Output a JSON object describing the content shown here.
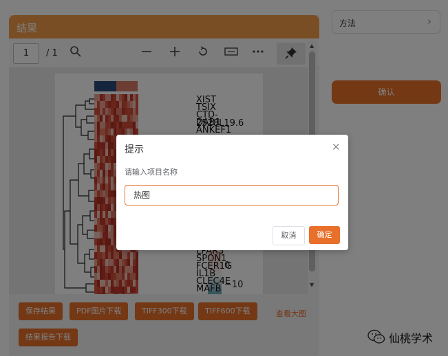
{
  "result_panel": {
    "title": "结果",
    "toolbar": {
      "page_number": "1",
      "page_total": "/ 1",
      "icons": [
        "search-icon",
        "zoom-out-icon",
        "zoom-in-icon",
        "rotate-icon",
        "fit-width-icon",
        "more-icon",
        "pin-icon"
      ]
    },
    "heatmap": {
      "genes": [
        "XIST",
        "TSIX",
        "CTD-2528L19.6",
        "DAB1",
        "ANKEF1",
        "LPAR3",
        "SPON1",
        "FCER1G",
        "IL1B",
        "CLEC4E",
        "MAFB"
      ],
      "color_scale_labels": [
        "0",
        "−10"
      ],
      "annotation_colors": [
        "#2c4a7c",
        "#d97a66"
      ]
    },
    "buttons": [
      "保存结果",
      "PDF图片下载",
      "TIFF300下载",
      "TIFF600下载",
      "结果报告下载"
    ],
    "view_large_link": "查看大图"
  },
  "sidebar": {
    "method_label": "方法",
    "confirm_label": "确认"
  },
  "watermark": "仙桃学术",
  "dialog": {
    "title": "提示",
    "message": "请输入项目名称",
    "input_value": "热图",
    "cancel_label": "取消",
    "ok_label": "确定"
  },
  "colors": {
    "accent": "#e8702b",
    "header": "#f39c4a"
  }
}
